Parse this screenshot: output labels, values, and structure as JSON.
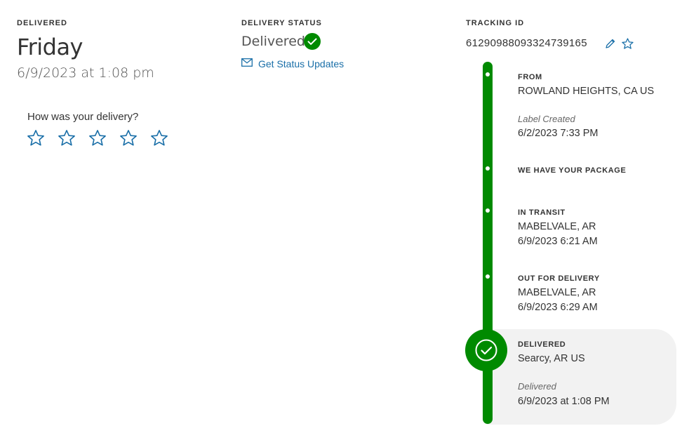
{
  "delivered_section": {
    "label": "DELIVERED",
    "day": "Friday",
    "datetime": "6/9/2023 at 1:08 pm",
    "question": "How was your delivery?",
    "stars": [
      0,
      0,
      0,
      0,
      0
    ]
  },
  "delivery_status": {
    "label": "DELIVERY STATUS",
    "value": "Delivered",
    "updates_link": "Get Status Updates"
  },
  "tracking": {
    "label": "TRACKING ID",
    "id": "612909880933247391​65"
  },
  "timeline": {
    "from": {
      "title": "FROM",
      "location": "ROWLAND HEIGHTS, CA US",
      "note": "Label Created",
      "datetime": "6/2/2023 7:33 PM"
    },
    "have_package": {
      "title": "WE HAVE YOUR PACKAGE"
    },
    "in_transit": {
      "title": "IN TRANSIT",
      "location": "MABELVALE, AR",
      "datetime": "6/9/2023 6:21 AM"
    },
    "out_for_delivery": {
      "title": "OUT FOR DELIVERY",
      "location": "MABELVALE, AR",
      "datetime": "6/9/2023 6:29 AM"
    },
    "delivered": {
      "title": "DELIVERED",
      "location": "Searcy, AR US",
      "note": "Delivered",
      "datetime": "6/9/2023 at 1:08 PM"
    }
  },
  "colors": {
    "green": "#008a00",
    "link": "#1a6fa8",
    "panel": "#f2f2f2"
  }
}
